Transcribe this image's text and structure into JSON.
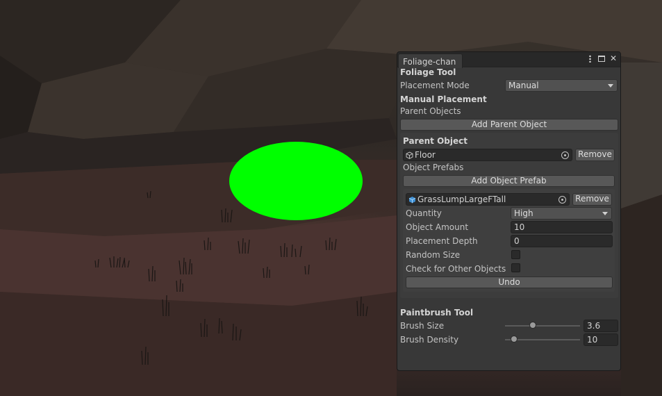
{
  "window": {
    "tab_title": "Foliage-chan"
  },
  "foliage_tool": {
    "header": "Foliage Tool",
    "placement_mode_label": "Placement Mode",
    "placement_mode_value": "Manual"
  },
  "manual_placement": {
    "header": "Manual Placement",
    "parent_objects_label": "Parent Objects",
    "add_parent_button": "Add Parent Object"
  },
  "parent_object": {
    "header": "Parent Object",
    "object_name": "Floor",
    "remove_button": "Remove",
    "object_prefabs_label": "Object Prefabs",
    "add_prefab_button": "Add Object Prefab"
  },
  "prefab": {
    "object_name": "GrassLumpLargeFTall",
    "remove_button": "Remove",
    "quantity_label": "Quantity",
    "quantity_value": "High",
    "object_amount_label": "Object Amount",
    "object_amount_value": "10",
    "placement_depth_label": "Placement Depth",
    "placement_depth_value": "0",
    "random_size_label": "Random Size",
    "random_size_checked": false,
    "check_other_label": "Check for Other Objects",
    "check_other_checked": false,
    "undo_button": "Undo"
  },
  "paintbrush_tool": {
    "header": "Paintbrush Tool",
    "brush_size_label": "Brush Size",
    "brush_size_value": "3.6",
    "brush_size_fraction": 0.37,
    "brush_density_label": "Brush Density",
    "brush_density_value": "10",
    "brush_density_fraction": 0.12
  },
  "colors": {
    "brush_cursor": "#00ff00",
    "panel_bg": "#383838"
  }
}
